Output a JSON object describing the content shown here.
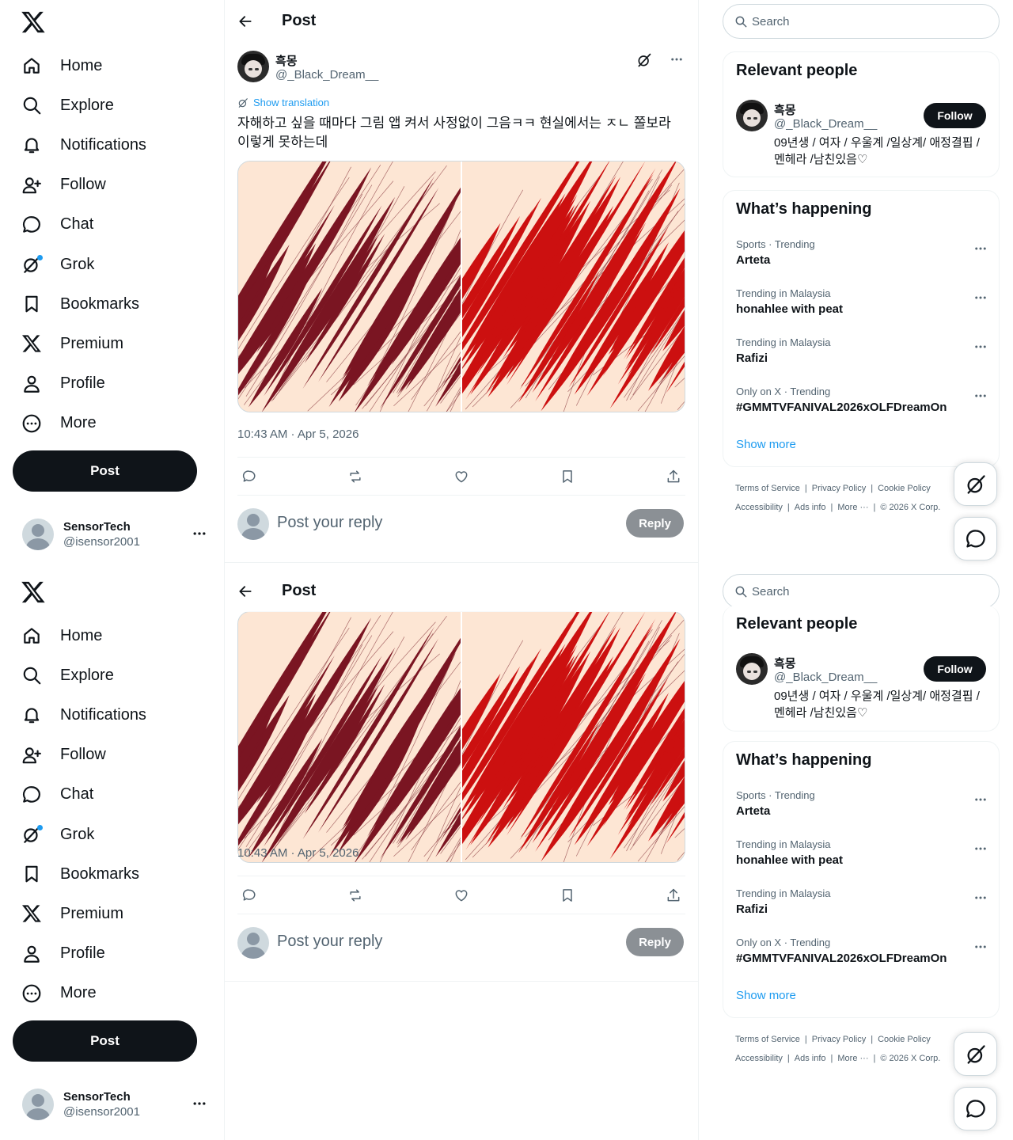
{
  "nav": {
    "items": [
      {
        "label": "Home",
        "icon": "home-icon"
      },
      {
        "label": "Explore",
        "icon": "search-icon"
      },
      {
        "label": "Notifications",
        "icon": "bell-icon"
      },
      {
        "label": "Follow",
        "icon": "person-add-icon"
      },
      {
        "label": "Chat",
        "icon": "chat-bubble-icon"
      },
      {
        "label": "Grok",
        "icon": "grok-icon"
      },
      {
        "label": "Bookmarks",
        "icon": "bookmark-icon"
      },
      {
        "label": "Premium",
        "icon": "x-logo-icon"
      },
      {
        "label": "Profile",
        "icon": "person-icon"
      },
      {
        "label": "More",
        "icon": "more-circle-icon"
      }
    ],
    "post_button": "Post"
  },
  "account": {
    "name": "SensorTech",
    "handle": "@isensor2001"
  },
  "header": {
    "title": "Post"
  },
  "post": {
    "author_name": "흑몽",
    "author_handle": "@_Black_Dream__",
    "show_translation": "Show translation",
    "text": "자해하고 싶을 때마다 그림 앱 켜서 사정없이 그음ㅋㅋ 현실에서는 ㅈㄴ 쫄보라 이렇게 못하는데",
    "timestamp": "10:43 AM · Apr 5, 2026",
    "reply_placeholder": "Post your reply",
    "reply_button": "Reply"
  },
  "search": {
    "placeholder": "Search"
  },
  "relevant": {
    "title": "Relevant people",
    "name": "흑몽",
    "handle": "@_Black_Dream__",
    "bio": "09년생 / 여자 / 우울계 /일상계/ 애정결핍 / 멘헤라 /남친있음♡",
    "follow": "Follow"
  },
  "happening": {
    "title": "What’s happening",
    "trends": [
      {
        "meta": "Sports · Trending",
        "name": "Arteta"
      },
      {
        "meta": "Trending in Malaysia",
        "name": "honahlee with peat"
      },
      {
        "meta": "Trending in Malaysia",
        "name": "Rafizi"
      },
      {
        "meta": "Only on X · Trending",
        "name": "#GMMTVFANIVAL2026xOLFDreamOn"
      }
    ],
    "show_more": "Show more"
  },
  "footer": {
    "links": [
      "Terms of Service",
      "Privacy Policy",
      "Cookie Policy",
      "Accessibility",
      "Ads info",
      "More ···",
      "© 2026 X Corp."
    ]
  },
  "colors": {
    "accent": "#1d9bf0",
    "dark": "#0f1419",
    "muted": "#536471",
    "image_bg": "#fde6d4",
    "stroke_dark": "#7a1522",
    "stroke_red": "#cc1010"
  }
}
